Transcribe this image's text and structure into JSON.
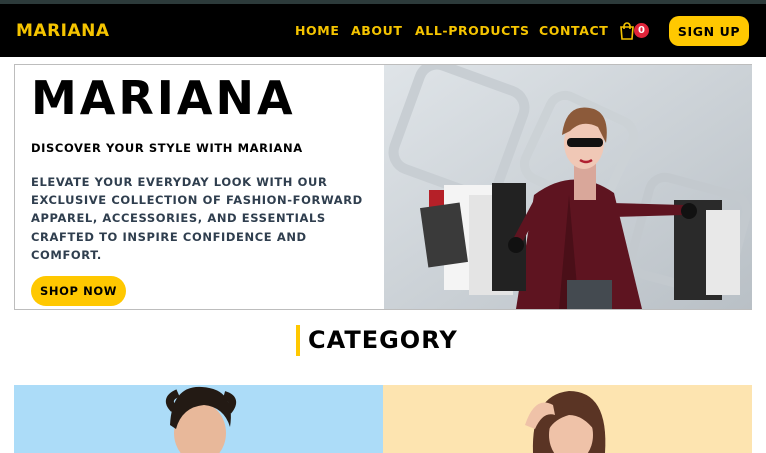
{
  "nav": {
    "brand": "MARIANA",
    "links": [
      "HOME",
      "ABOUT",
      "ALL-PRODUCTS",
      "CONTACT"
    ],
    "cart_count": "0",
    "signup_label": "SIGN UP"
  },
  "hero": {
    "title": "MARIANA",
    "subtitle": "DISCOVER YOUR STYLE WITH MARIANA",
    "description": "ELEVATE YOUR EVERYDAY LOOK WITH OUR EXCLUSIVE COLLECTION OF FASHION-FORWARD APPAREL, ACCESSORIES, AND ESSENTIALS CRAFTED TO INSPIRE CONFIDENCE AND COMFORT.",
    "cta_label": "SHOP NOW"
  },
  "category": {
    "heading": "CATEGORY"
  },
  "colors": {
    "accent": "#ffc800",
    "navbar": "#000000",
    "badge": "#e0243a",
    "card_men_bg": "#acdcf8",
    "card_women_bg": "#fde4b0"
  },
  "icons": {
    "cart": "shopping-bag-icon"
  }
}
